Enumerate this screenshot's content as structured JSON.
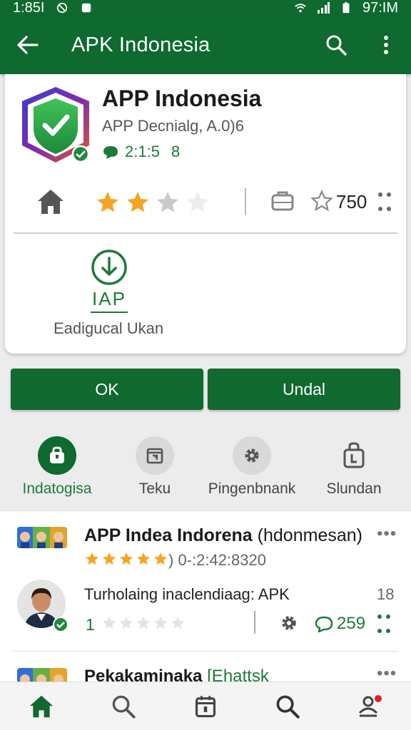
{
  "status_bar": {
    "time": "1:85I",
    "right_text": "97:IM"
  },
  "app_bar": {
    "title": "APK Indonesia",
    "back_icon": "arrow-left-icon",
    "search_icon": "search-icon",
    "more_icon": "more-vert-icon"
  },
  "app_card": {
    "name": "APP Indonesia",
    "developer": "APP Decnialg, A.0)6",
    "meta_value": "2:1:5",
    "meta_count": "8",
    "rating_stars": 2,
    "rating_max": 4,
    "review_count": "750",
    "iap_label": "IAP",
    "iap_caption": "Eadigucal Ukan"
  },
  "buttons": {
    "ok": "OK",
    "undal": "Undal"
  },
  "categories": [
    {
      "label": "Indatogisa",
      "icon": "bag-icon",
      "active": true
    },
    {
      "label": "Teku",
      "icon": "calendar-icon",
      "active": false
    },
    {
      "label": "Pingenbnank",
      "icon": "gear-icon",
      "active": false
    },
    {
      "label": "Slundan",
      "icon": "lock-bag-icon",
      "active": false
    }
  ],
  "list": {
    "row1": {
      "title": "APP Indea Indorena",
      "title_suffix": "(hdonmesan)",
      "stars": 5,
      "meta": ") 0-:2:42:8320",
      "more": "•••"
    },
    "row2": {
      "title": "Turholaing inaclendiaag: APK",
      "number": "18",
      "rating": "1",
      "comments": "259"
    },
    "row3": {
      "title": "Pekakaminaka",
      "title_suffix": "[Ehattsk",
      "more": "•••"
    }
  },
  "bottom_nav": [
    "home-icon",
    "search-icon",
    "calendar-icon",
    "search-icon",
    "account-icon"
  ],
  "colors": {
    "primary": "#0e6a2f",
    "accent_green": "#1e7a38",
    "star": "#f4a623"
  }
}
